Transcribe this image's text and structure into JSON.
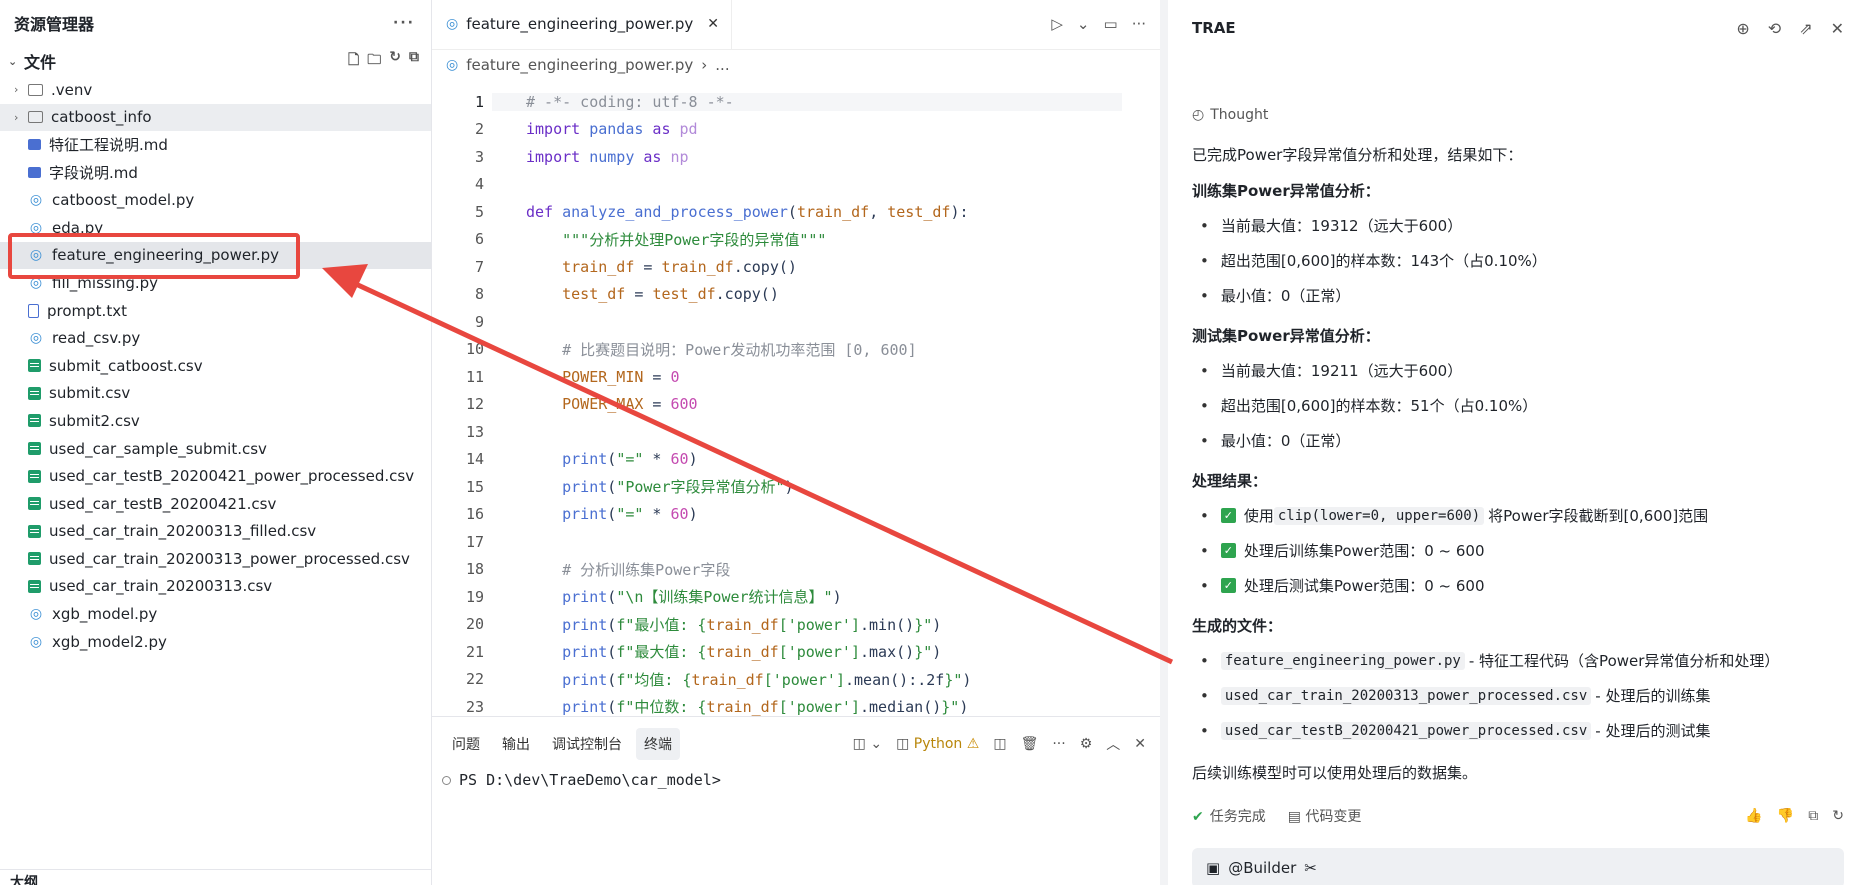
{
  "explorer": {
    "title": "资源管理器",
    "more": "···",
    "folder": "文件",
    "items": [
      {
        "name": ".venv",
        "type": "folder"
      },
      {
        "name": "catboost_info",
        "type": "folder"
      },
      {
        "name": "特征工程说明.md",
        "type": "md"
      },
      {
        "name": "字段说明.md",
        "type": "md"
      },
      {
        "name": "catboost_model.py",
        "type": "py"
      },
      {
        "name": "eda.py",
        "type": "py"
      },
      {
        "name": "feature_engineering_power.py",
        "type": "py"
      },
      {
        "name": "fill_missing.py",
        "type": "py"
      },
      {
        "name": "prompt.txt",
        "type": "txt"
      },
      {
        "name": "read_csv.py",
        "type": "py"
      },
      {
        "name": "submit_catboost.csv",
        "type": "csv"
      },
      {
        "name": "submit.csv",
        "type": "csv"
      },
      {
        "name": "submit2.csv",
        "type": "csv"
      },
      {
        "name": "used_car_sample_submit.csv",
        "type": "csv"
      },
      {
        "name": "used_car_testB_20200421_power_processed.csv",
        "type": "csv"
      },
      {
        "name": "used_car_testB_20200421.csv",
        "type": "csv"
      },
      {
        "name": "used_car_train_20200313_filled.csv",
        "type": "csv"
      },
      {
        "name": "used_car_train_20200313_power_processed.csv",
        "type": "csv"
      },
      {
        "name": "used_car_train_20200313.csv",
        "type": "csv"
      },
      {
        "name": "xgb_model.py",
        "type": "py"
      },
      {
        "name": "xgb_model2.py",
        "type": "py"
      }
    ],
    "outline": "大纲"
  },
  "editor": {
    "tab": "feature_engineering_power.py",
    "breadcrumb_file": "feature_engineering_power.py",
    "breadcrumb_more": "...",
    "lines": [
      {
        "n": "1",
        "t": [
          [
            "com",
            "# -*- coding: utf-8 -*-"
          ]
        ]
      },
      {
        "n": "2",
        "t": [
          [
            "kw",
            "import "
          ],
          [
            "fn",
            "pandas"
          ],
          [
            "kw",
            " as "
          ],
          [
            "dim",
            "pd"
          ]
        ]
      },
      {
        "n": "3",
        "t": [
          [
            "kw",
            "import "
          ],
          [
            "fn",
            "numpy"
          ],
          [
            "kw",
            " as "
          ],
          [
            "dim",
            "np"
          ]
        ]
      },
      {
        "n": "4",
        "t": []
      },
      {
        "n": "5",
        "t": [
          [
            "kw",
            "def "
          ],
          [
            "fn",
            "analyze_and_process_power"
          ],
          [
            "plain",
            "("
          ],
          [
            "var",
            "train_df"
          ],
          [
            "plain",
            ", "
          ],
          [
            "var",
            "test_df"
          ],
          [
            "plain",
            "):"
          ]
        ]
      },
      {
        "n": "6",
        "t": [
          [
            "str",
            "    \"\"\"分析并处理Power字段的异常值\"\"\""
          ]
        ]
      },
      {
        "n": "7",
        "t": [
          [
            "plain",
            "    "
          ],
          [
            "var",
            "train_df"
          ],
          [
            "plain",
            " = "
          ],
          [
            "var",
            "train_df"
          ],
          [
            "plain",
            ".copy()"
          ]
        ]
      },
      {
        "n": "8",
        "t": [
          [
            "plain",
            "    "
          ],
          [
            "var",
            "test_df"
          ],
          [
            "plain",
            " = "
          ],
          [
            "var",
            "test_df"
          ],
          [
            "plain",
            ".copy()"
          ]
        ]
      },
      {
        "n": "9",
        "t": []
      },
      {
        "n": "10",
        "t": [
          [
            "com",
            "    # 比赛题目说明：Power发动机功率范围 [0, 600]"
          ]
        ]
      },
      {
        "n": "11",
        "t": [
          [
            "plain",
            "    "
          ],
          [
            "var",
            "POWER_MIN"
          ],
          [
            "plain",
            " = "
          ],
          [
            "num",
            "0"
          ]
        ]
      },
      {
        "n": "12",
        "t": [
          [
            "plain",
            "    "
          ],
          [
            "var",
            "POWER_MAX"
          ],
          [
            "plain",
            " = "
          ],
          [
            "num",
            "600"
          ]
        ]
      },
      {
        "n": "13",
        "t": []
      },
      {
        "n": "14",
        "t": [
          [
            "plain",
            "    "
          ],
          [
            "fn",
            "print"
          ],
          [
            "plain",
            "("
          ],
          [
            "str",
            "\"=\""
          ],
          [
            "plain",
            " * "
          ],
          [
            "num",
            "60"
          ],
          [
            "plain",
            ")"
          ]
        ]
      },
      {
        "n": "15",
        "t": [
          [
            "plain",
            "    "
          ],
          [
            "fn",
            "print"
          ],
          [
            "plain",
            "("
          ],
          [
            "str",
            "\"Power字段异常值分析\""
          ],
          [
            "plain",
            ")"
          ]
        ]
      },
      {
        "n": "16",
        "t": [
          [
            "plain",
            "    "
          ],
          [
            "fn",
            "print"
          ],
          [
            "plain",
            "("
          ],
          [
            "str",
            "\"=\""
          ],
          [
            "plain",
            " * "
          ],
          [
            "num",
            "60"
          ],
          [
            "plain",
            ")"
          ]
        ]
      },
      {
        "n": "17",
        "t": []
      },
      {
        "n": "18",
        "t": [
          [
            "com",
            "    # 分析训练集Power字段"
          ]
        ]
      },
      {
        "n": "19",
        "t": [
          [
            "plain",
            "    "
          ],
          [
            "fn",
            "print"
          ],
          [
            "plain",
            "("
          ],
          [
            "str",
            "\"\\n【训练集Power统计信息】\""
          ],
          [
            "plain",
            ")"
          ]
        ]
      },
      {
        "n": "20",
        "t": [
          [
            "plain",
            "    "
          ],
          [
            "fn",
            "print"
          ],
          [
            "plain",
            "("
          ],
          [
            "str",
            "f\"最小值: {"
          ],
          [
            "var",
            "train_df"
          ],
          [
            "str",
            "['power']"
          ],
          [
            "plain",
            ".min()"
          ],
          [
            "str",
            "}\""
          ],
          [
            "plain",
            ")"
          ]
        ]
      },
      {
        "n": "21",
        "t": [
          [
            "plain",
            "    "
          ],
          [
            "fn",
            "print"
          ],
          [
            "plain",
            "("
          ],
          [
            "str",
            "f\"最大值: {"
          ],
          [
            "var",
            "train_df"
          ],
          [
            "str",
            "['power']"
          ],
          [
            "plain",
            ".max()"
          ],
          [
            "str",
            "}\""
          ],
          [
            "plain",
            ")"
          ]
        ]
      },
      {
        "n": "22",
        "t": [
          [
            "plain",
            "    "
          ],
          [
            "fn",
            "print"
          ],
          [
            "plain",
            "("
          ],
          [
            "str",
            "f\"均值: {"
          ],
          [
            "var",
            "train_df"
          ],
          [
            "str",
            "['power']"
          ],
          [
            "plain",
            ".mean():.2f"
          ],
          [
            "str",
            "}\""
          ],
          [
            "plain",
            ")"
          ]
        ]
      },
      {
        "n": "23",
        "t": [
          [
            "plain",
            "    "
          ],
          [
            "fn",
            "print"
          ],
          [
            "plain",
            "("
          ],
          [
            "str",
            "f\"中位数: {"
          ],
          [
            "var",
            "train_df"
          ],
          [
            "str",
            "['power']"
          ],
          [
            "plain",
            ".median()"
          ],
          [
            "str",
            "}\""
          ],
          [
            "plain",
            ")"
          ]
        ]
      }
    ]
  },
  "panel": {
    "tabs": [
      "问题",
      "输出",
      "调试控制台",
      "终端"
    ],
    "active_tab": "终端",
    "python_label": "Python",
    "prompt": "PS D:\\dev\\TraeDemo\\car_model>"
  },
  "chat": {
    "title": "TRAE",
    "thought": "Thought",
    "intro": "已完成Power字段异常值分析和处理，结果如下：",
    "train_heading": "训练集Power异常值分析：",
    "train_bullets": [
      "当前最大值：19312（远大于600）",
      "超出范围[0,600]的样本数：143个（占0.10%）",
      "最小值：0（正常）"
    ],
    "test_heading": "测试集Power异常值分析：",
    "test_bullets": [
      "当前最大值：19211（远大于600）",
      "超出范围[0,600]的样本数：51个（占0.10%）",
      "最小值：0（正常）"
    ],
    "result_heading": "处理结果：",
    "result_bullets": [
      {
        "pre": "使用 ",
        "code": "clip(lower=0, upper=600)",
        "post": "将Power字段截断到[0,600]范围"
      },
      {
        "pre": "处理后训练集Power范围：0 ~ 600",
        "code": "",
        "post": ""
      },
      {
        "pre": "处理后测试集Power范围：0 ~ 600",
        "code": "",
        "post": ""
      }
    ],
    "files_heading": "生成的文件：",
    "files": [
      {
        "code": "feature_engineering_power.py",
        "desc": "- 特征工程代码（含Power异常值分析和处理）"
      },
      {
        "code": "used_car_train_20200313_power_processed.csv",
        "desc": "- 处理后的训练集"
      },
      {
        "code": "used_car_testB_20200421_power_processed.csv",
        "desc": "- 处理后的测试集"
      }
    ],
    "closing": "后续训练模型时可以使用处理后的数据集。",
    "status": "任务完成",
    "code_changes": "代码变更",
    "composer_agent": "@Builder"
  }
}
